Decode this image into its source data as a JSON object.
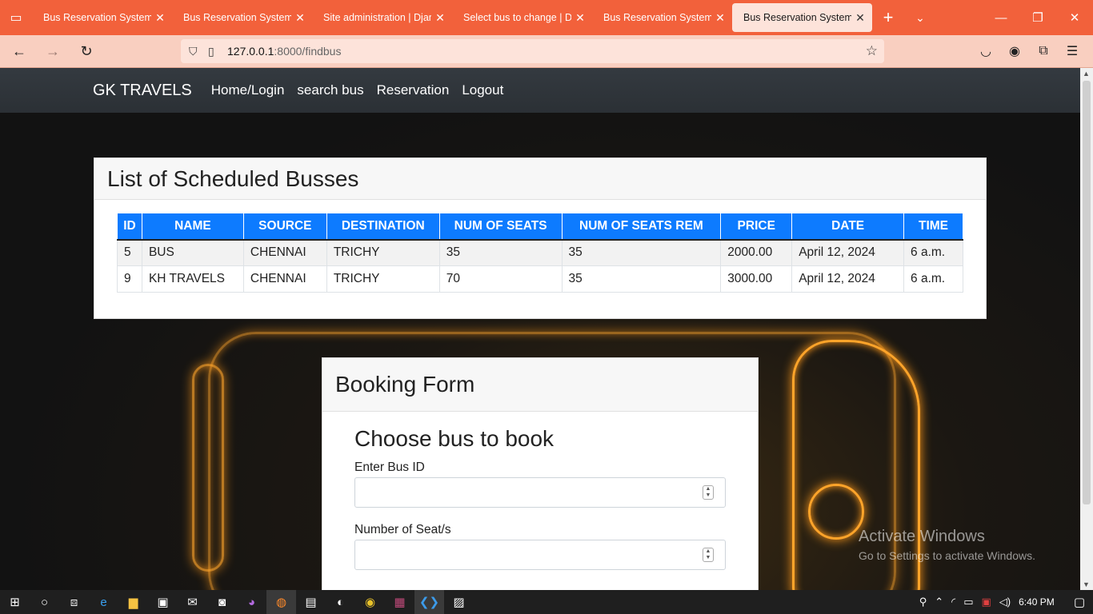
{
  "browser": {
    "tabs": [
      {
        "title": "Bus Reservation System in",
        "active": false
      },
      {
        "title": "Bus Reservation System in",
        "active": false
      },
      {
        "title": "Site administration | Django",
        "active": false
      },
      {
        "title": "Select bus to change | Djan",
        "active": false
      },
      {
        "title": "Bus Reservation System in",
        "active": false
      },
      {
        "title": "Bus Reservation System in",
        "active": true
      }
    ],
    "url_host": "127.0.0.1",
    "url_path": ":8000/findbus"
  },
  "site": {
    "brand": "GK TRAVELS",
    "nav": [
      "Home/Login",
      "search bus",
      "Reservation",
      "Logout"
    ]
  },
  "schedule": {
    "title": "List of Scheduled Busses",
    "columns": [
      "ID",
      "NAME",
      "SOURCE",
      "DESTINATION",
      "NUM OF SEATS",
      "NUM OF SEATS REM",
      "PRICE",
      "DATE",
      "TIME"
    ],
    "rows": [
      [
        "5",
        "BUS",
        "CHENNAI",
        "TRICHY",
        "35",
        "35",
        "2000.00",
        "April 12, 2024",
        "6 a.m."
      ],
      [
        "9",
        "KH TRAVELS",
        "CHENNAI",
        "TRICHY",
        "70",
        "35",
        "3000.00",
        "April 12, 2024",
        "6 a.m."
      ]
    ]
  },
  "booking": {
    "header": "Booking Form",
    "title": "Choose bus to book",
    "bus_id_label": "Enter Bus ID",
    "bus_id_value": "",
    "seats_label": "Number of Seat/s",
    "seats_value": ""
  },
  "watermark": {
    "line1": "Activate Windows",
    "line2": "Go to Settings to activate Windows."
  },
  "taskbar": {
    "time": "6:40 PM"
  }
}
